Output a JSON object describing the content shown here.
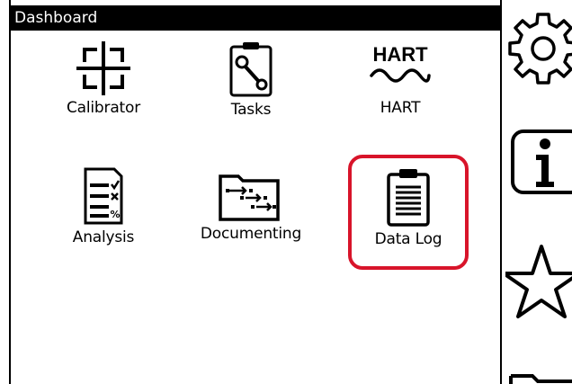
{
  "titlebar": {
    "title": "Dashboard"
  },
  "apps": [
    {
      "label": "Calibrator",
      "icon": "crosshair-icon"
    },
    {
      "label": "Tasks",
      "icon": "clipboard-wrench-icon"
    },
    {
      "label": "HART",
      "icon": "hart-wave-icon",
      "icon_text": "HART"
    },
    {
      "label": "Analysis",
      "icon": "analysis-list-icon"
    },
    {
      "label": "Documenting",
      "icon": "folder-flow-icon"
    },
    {
      "label": "Data Log",
      "icon": "clipboard-list-icon",
      "selected": true
    }
  ],
  "sidebar": [
    {
      "icon": "gear-icon"
    },
    {
      "icon": "info-icon"
    },
    {
      "icon": "star-icon"
    },
    {
      "icon": "folder-icon"
    }
  ],
  "colors": {
    "selection": "#d8142a",
    "titlebar_bg": "#000000",
    "titlebar_text": "#ffffff"
  }
}
